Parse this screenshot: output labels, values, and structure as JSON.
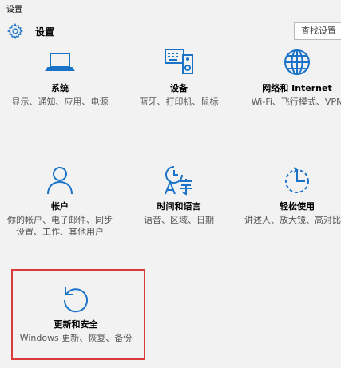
{
  "window": {
    "title": "设置"
  },
  "header": {
    "title": "设置"
  },
  "search": {
    "placeholder": "查找设置"
  },
  "colors": {
    "accent": "#1a73c9",
    "highlight": "#d93a3a"
  },
  "tiles": [
    {
      "icon": "laptop-icon",
      "name": "系统",
      "desc": "显示、通知、应用、电源"
    },
    {
      "icon": "devices-icon",
      "name": "设备",
      "desc": "蓝牙、打印机、鼠标"
    },
    {
      "icon": "globe-icon",
      "name": "网络和 Internet",
      "desc": "Wi-Fi、飞行模式、VPN"
    },
    {
      "icon": "person-icon",
      "name": "帐户",
      "desc": "你的帐户、电子邮件、同步设置、工作、其他用户"
    },
    {
      "icon": "time-language-icon",
      "name": "时间和语言",
      "desc": "语音、区域、日期"
    },
    {
      "icon": "accessibility-icon",
      "name": "轻松使用",
      "desc": "讲述人、放大镜、高对比度"
    },
    {
      "icon": "update-icon",
      "name": "更新和安全",
      "desc": "Windows 更新、恢复、备份"
    }
  ]
}
